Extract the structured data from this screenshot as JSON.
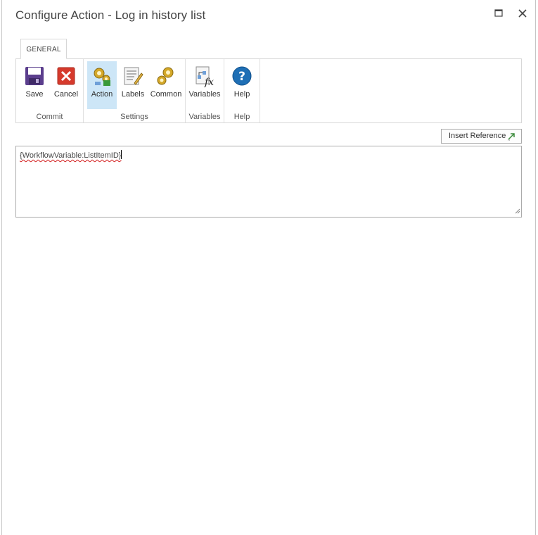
{
  "window": {
    "title": "Configure Action - Log in history list"
  },
  "ribbon": {
    "tab": "GENERAL",
    "groups": [
      {
        "label": "Commit",
        "buttons": [
          {
            "label": "Save",
            "icon": "save-icon"
          },
          {
            "label": "Cancel",
            "icon": "cancel-icon"
          }
        ]
      },
      {
        "label": "Settings",
        "buttons": [
          {
            "label": "Action",
            "icon": "gears-action-icon",
            "active": true
          },
          {
            "label": "Labels",
            "icon": "labels-icon"
          },
          {
            "label": "Common",
            "icon": "gears-icon"
          }
        ]
      },
      {
        "label": "Variables",
        "buttons": [
          {
            "label": "Variables",
            "icon": "variables-fx-icon"
          }
        ]
      },
      {
        "label": "Help",
        "buttons": [
          {
            "label": "Help",
            "icon": "help-icon"
          }
        ]
      }
    ]
  },
  "insert_reference": {
    "label": "Insert Reference"
  },
  "editor": {
    "value": "{WorkflowVariable:ListItemID}"
  },
  "colors": {
    "active_button_bg": "#cde6f7",
    "help_blue": "#1f6fb5",
    "cancel_red": "#d63a2c",
    "save_purple": "#5b3e8d"
  }
}
